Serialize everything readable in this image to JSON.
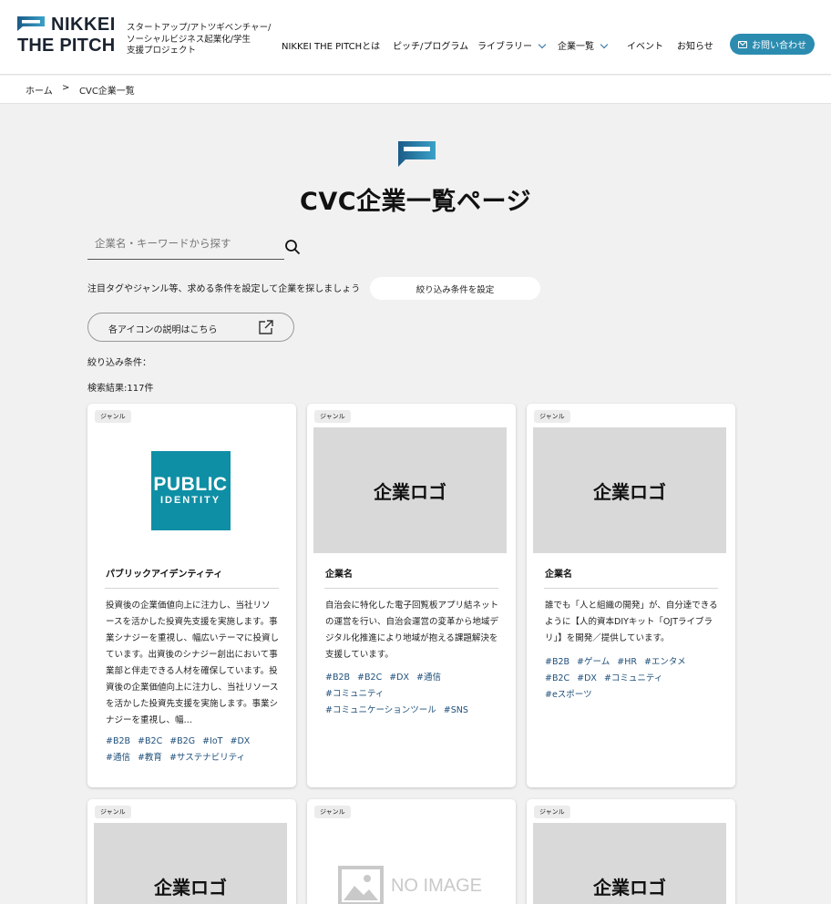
{
  "header": {
    "logo_line1": "NIKKEI",
    "logo_line2": "THE PITCH",
    "tagline_line1": "スタートアップ/アトツギベンチャー/",
    "tagline_line2": "ソーシャルビジネス起業化/学生",
    "tagline_line3": "支援プロジェクト",
    "nav": [
      {
        "label": "NIKKEI THE PITCHとは"
      },
      {
        "label": "ピッチ/プログラム"
      },
      {
        "label": "ライブラリー"
      },
      {
        "label": "企業一覧"
      },
      {
        "label": "イベント"
      },
      {
        "label": "お知らせ"
      }
    ],
    "contact_label": "お問い合わせ",
    "accent_color": "#2b8cb0"
  },
  "breadcrumb": {
    "home": "ホーム",
    "separator": ">",
    "current": "CVC企業一覧"
  },
  "page": {
    "title": "CVC企業一覧ページ",
    "search_placeholder": "企業名・キーワードから探す",
    "filter_hint": "注目タグやジャンル等、求める条件を設定して企業を探しましょう",
    "filter_button": "絞り込み条件を設定",
    "icon_help": "各アイコンの説明はこちら",
    "conditions_label": "絞り込み条件：",
    "results": "検索結果:117件"
  },
  "cards": [
    {
      "genre": "ジャンル",
      "logo_line1": "PUBLIC",
      "logo_line2": "IDENTITY",
      "name": "パブリックアイデンティティ",
      "desc": "投資後の企業価値向上に注力し、当社リソースを活かした投資先支援を実施します。事業シナジーを重視し、幅広いテーマに投資しています。出資後のシナジー創出において事業部と伴走できる人材を確保しています。投資後の企業価値向上に注力し、当社リソースを活かした投資先支援を実施します。事業シナジーを重視し、幅…",
      "tags": [
        "#B2B",
        "#B2C",
        "#B2G",
        "#IoT",
        "#DX",
        "#通信",
        "#教育",
        "#サステナビリティ"
      ]
    },
    {
      "genre": "ジャンル",
      "logo_text": "企業ロゴ",
      "name": "企業名",
      "desc": "自治会に特化した電子回覧板アプリ結ネットの運営を行い、自治会運営の変革から地域デジタル化推進により地域が抱える課題解決を支援しています。",
      "tags": [
        "#B2B",
        "#B2C",
        "#DX",
        "#通信",
        "#コミュニティ",
        "#コミュニケーションツール",
        "#SNS"
      ]
    },
    {
      "genre": "ジャンル",
      "logo_text": "企業ロゴ",
      "name": "企業名",
      "desc": "誰でも「人と組織の開発」が、自分達できるように【人的資本DIYキット「OJTライブラリ」】を開発／提供しています。",
      "tags": [
        "#B2B",
        "#ゲーム",
        "#HR",
        "#エンタメ",
        "#B2C",
        "#DX",
        "#コミュニティ",
        "#eスポーツ"
      ]
    },
    {
      "genre": "ジャンル",
      "logo_text": "企業ロゴ"
    },
    {
      "genre": "ジャンル",
      "logo_text": "NO IMAGE"
    },
    {
      "genre": "ジャンル",
      "logo_text": "企業ロゴ"
    }
  ]
}
